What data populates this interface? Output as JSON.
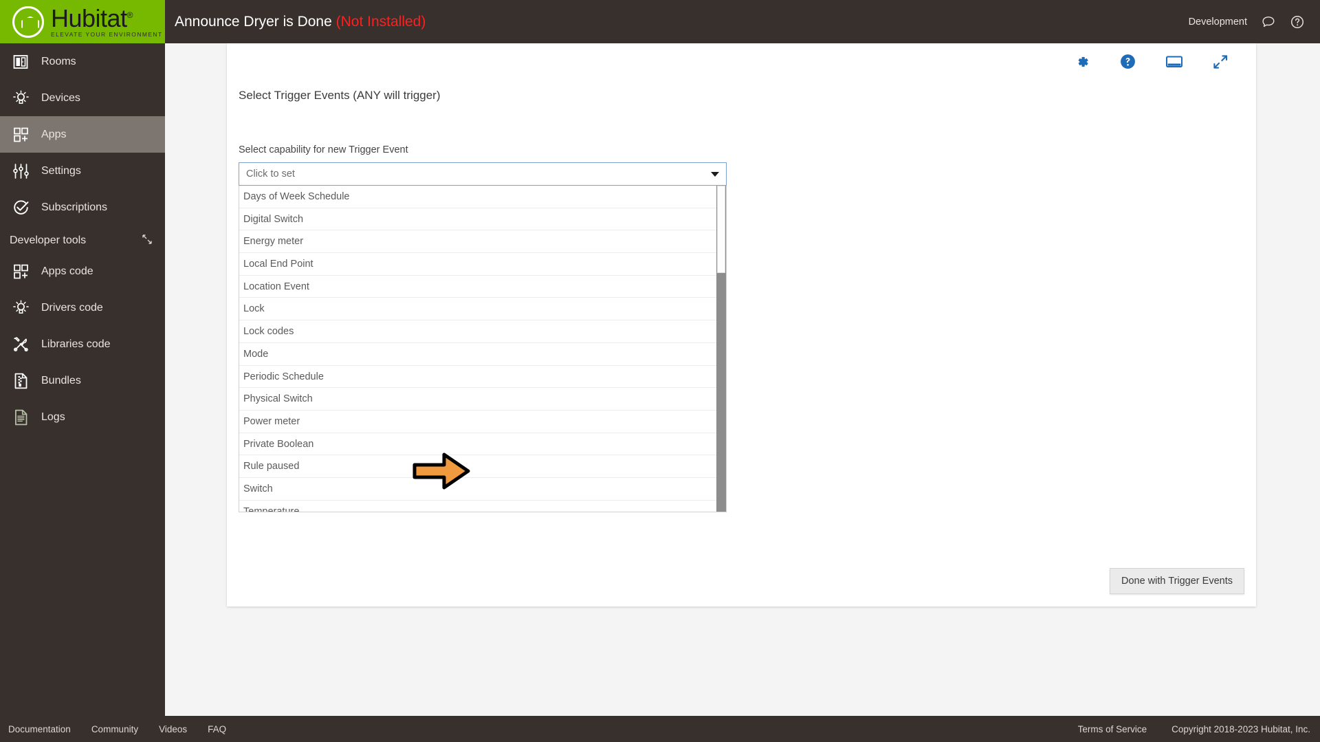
{
  "brand": {
    "name": "Hubitat",
    "registered": "®",
    "tagline": "ELEVATE YOUR ENVIRONMENT",
    "green": "#76b900",
    "dark": "#38302c"
  },
  "topbar": {
    "app_title": "Announce Dryer is Done",
    "app_status": "(Not Installed)",
    "status_color": "#ff1f1f",
    "environment": "Development",
    "chat_icon": "chat-bubble-icon",
    "help_icon": "help-circle-icon"
  },
  "sidebar": {
    "items": [
      {
        "label": "Rooms",
        "icon": "rooms-icon",
        "active": false
      },
      {
        "label": "Devices",
        "icon": "devices-bulb-icon",
        "active": false
      },
      {
        "label": "Apps",
        "icon": "apps-grid-icon",
        "active": true
      },
      {
        "label": "Settings",
        "icon": "settings-sliders-icon",
        "active": false
      },
      {
        "label": "Subscriptions",
        "icon": "subscriptions-check-icon",
        "active": false
      }
    ],
    "developer_tools": {
      "label": "Developer tools",
      "collapse_icon": "collapse-icon",
      "items": [
        {
          "label": "Apps code",
          "icon": "apps-code-grid-icon"
        },
        {
          "label": "Drivers code",
          "icon": "drivers-code-bulb-icon"
        },
        {
          "label": "Libraries code",
          "icon": "libraries-code-tools-icon"
        },
        {
          "label": "Bundles",
          "icon": "bundles-zip-icon"
        },
        {
          "label": "Logs",
          "icon": "logs-document-icon"
        }
      ]
    }
  },
  "card": {
    "tools": [
      {
        "name": "gear-icon",
        "label": "Settings"
      },
      {
        "name": "help-circle-filled-icon",
        "label": "Help"
      },
      {
        "name": "display-icon",
        "label": "Display"
      },
      {
        "name": "expand-arrows-icon",
        "label": "Expand"
      }
    ],
    "accent_color": "#1e6bb8",
    "section_title": "Select Trigger Events (ANY will trigger)",
    "field_label": "Select capability for new Trigger Event",
    "select": {
      "value": "Click to set",
      "placeholder": "Click to set",
      "caret_icon": "chevron-down-icon",
      "open": true
    },
    "dropdown_options": [
      "Days of Week Schedule",
      "Digital Switch",
      "Energy meter",
      "Local End Point",
      "Location Event",
      "Lock",
      "Lock codes",
      "Mode",
      "Periodic Schedule",
      "Physical Switch",
      "Power meter",
      "Private Boolean",
      "Rule paused",
      "Switch",
      "Temperature"
    ],
    "annotation": {
      "target_option": "Power meter",
      "arrow_icon": "arrow-right-annotation",
      "fill": "#ef9a3e",
      "stroke": "#000000"
    },
    "done_button": "Done with Trigger Events"
  },
  "footer": {
    "left_links": [
      "Documentation",
      "Community",
      "Videos",
      "FAQ"
    ],
    "right_links": [
      "Terms of Service"
    ],
    "copyright": "Copyright 2018-2023 Hubitat, Inc."
  }
}
